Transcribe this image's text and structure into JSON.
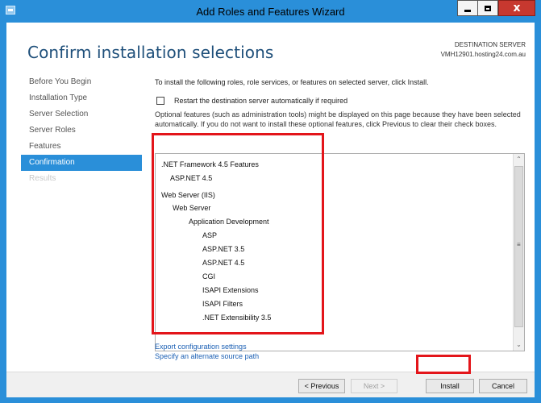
{
  "window": {
    "title": "Add Roles and Features Wizard",
    "controls": {
      "close_glyph": "x"
    }
  },
  "header": {
    "page_title": "Confirm installation selections",
    "destination_label": "DESTINATION SERVER",
    "destination_value": "VMH12901.hosting24.com.au"
  },
  "nav": {
    "items": [
      {
        "label": "Before You Begin",
        "state": "normal"
      },
      {
        "label": "Installation Type",
        "state": "normal"
      },
      {
        "label": "Server Selection",
        "state": "normal"
      },
      {
        "label": "Server Roles",
        "state": "normal"
      },
      {
        "label": "Features",
        "state": "normal"
      },
      {
        "label": "Confirmation",
        "state": "active"
      },
      {
        "label": "Results",
        "state": "disabled"
      }
    ]
  },
  "main": {
    "intro": "To install the following roles, role services, or features on selected server, click Install.",
    "restart_checkbox": {
      "label": "Restart the destination server automatically if required",
      "checked": false
    },
    "optional_text": "Optional features (such as administration tools) might be displayed on this page because they have been selected automatically. If you do not want to install these optional features, click Previous to clear their check boxes.",
    "features": [
      {
        "label": ".NET Framework 4.5 Features",
        "level": 0
      },
      {
        "label": "ASP.NET 4.5",
        "level": 1
      },
      {
        "label": "Web Server (IIS)",
        "level": 0
      },
      {
        "label": "Web Server",
        "level": 1
      },
      {
        "label": "Application Development",
        "level": 2
      },
      {
        "label": "ASP",
        "level": 3
      },
      {
        "label": "ASP.NET 3.5",
        "level": 3
      },
      {
        "label": "ASP.NET 4.5",
        "level": 3
      },
      {
        "label": "CGI",
        "level": 3
      },
      {
        "label": "ISAPI Extensions",
        "level": 3
      },
      {
        "label": "ISAPI Filters",
        "level": 3
      },
      {
        "label": ".NET Extensibility 3.5",
        "level": 3
      }
    ],
    "links": {
      "export": "Export configuration settings",
      "alternate_source": "Specify an alternate source path"
    }
  },
  "footer": {
    "previous": "< Previous",
    "next": "Next >",
    "install": "Install",
    "cancel": "Cancel"
  },
  "colors": {
    "accent": "#2a8fd9",
    "title_text": "#1e4f7a",
    "highlight": "#e3151a",
    "link": "#1a5fb4"
  }
}
